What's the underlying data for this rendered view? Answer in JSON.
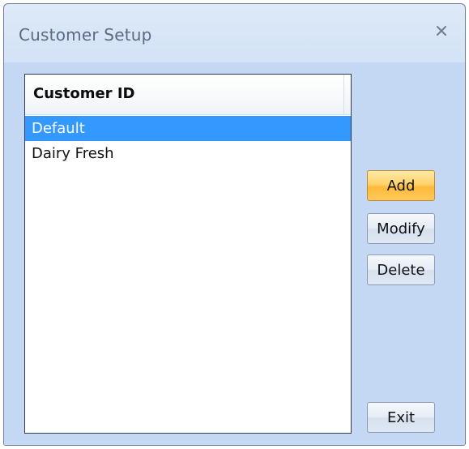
{
  "window": {
    "title": "Customer Setup",
    "close_symbol": "X",
    "close_icon": "close-icon"
  },
  "list": {
    "column_header": "Customer ID",
    "items": [
      {
        "label": "Default",
        "selected": true
      },
      {
        "label": "Dairy Fresh",
        "selected": false
      }
    ]
  },
  "buttons": {
    "add_label": "Add",
    "modify_label": "Modify",
    "delete_label": "Delete",
    "exit_label": "Exit"
  },
  "colors": {
    "selection": "#3399ff",
    "primary_button": "#ffc85c",
    "window_background": "#c4d8f3"
  }
}
